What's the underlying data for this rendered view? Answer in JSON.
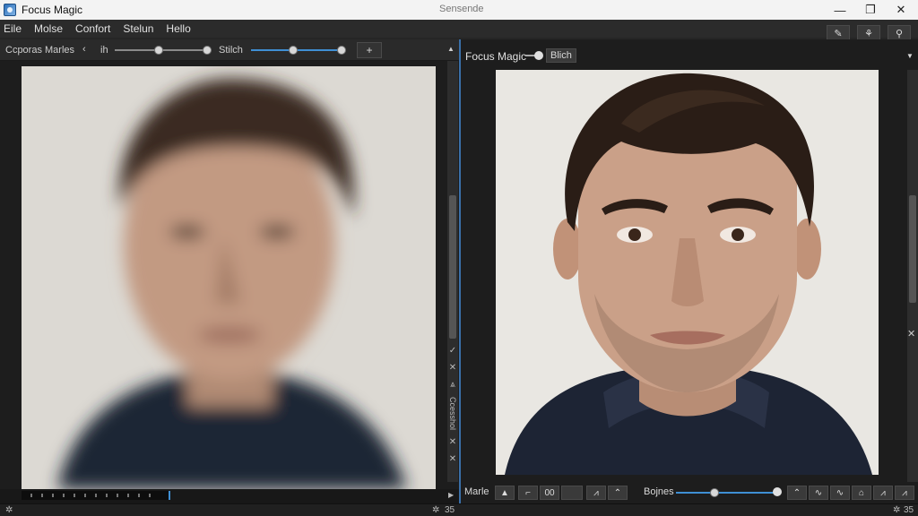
{
  "window": {
    "title": "Focus Magic",
    "subtitle": "Sensende",
    "controls": {
      "minimize": "—",
      "maximize": "❐",
      "close": "✕"
    }
  },
  "menu": [
    {
      "label": "Eile"
    },
    {
      "label": "Molse"
    },
    {
      "label": "Confort"
    },
    {
      "label": "Stelun"
    },
    {
      "label": "Hello"
    }
  ],
  "top_tools": [
    {
      "icon": "pen-icon",
      "glyph": "✎"
    },
    {
      "icon": "stamp-icon",
      "glyph": "⚘"
    },
    {
      "icon": "pin-icon",
      "glyph": "⚲"
    }
  ],
  "left_toolbar": {
    "label": "Ccporas Marles",
    "chevron": "‹",
    "mode": "ih",
    "value_label": "Stilch",
    "add": "+",
    "collapse": "▲",
    "slider1_level": 0.45,
    "slider2_level": 0.45
  },
  "right_header": {
    "title": "Focus Magic",
    "toggle_label": "Blich",
    "collapse": "▼"
  },
  "left_side_icons": [
    "✓",
    "✕",
    "⩓",
    "Ccesshol",
    "✕",
    "✕"
  ],
  "right_side_icons": {
    "close": "✕"
  },
  "right_bottom": {
    "mode_label": "Marle",
    "value_box": "00",
    "brush_label": "Bojnes",
    "brush_level": 0.38,
    "buttons": [
      "▲",
      "⌐",
      "⌃",
      "⩘",
      "⌂",
      "⌃",
      "∿",
      "∿",
      "⩘"
    ]
  },
  "status": {
    "left_icon": "✲",
    "mid_icons": [
      "✲",
      "35"
    ],
    "right_icons": [
      "✲",
      "35"
    ]
  }
}
